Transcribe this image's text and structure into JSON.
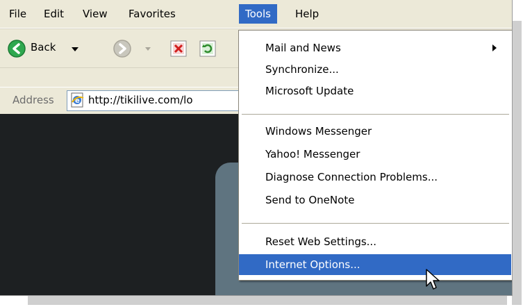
{
  "menubar": {
    "items": [
      {
        "label": "File"
      },
      {
        "label": "Edit"
      },
      {
        "label": "View"
      },
      {
        "label": "Favorites"
      },
      {
        "label": "Tools"
      },
      {
        "label": "Help"
      }
    ]
  },
  "toolbar": {
    "back_label": "Back"
  },
  "addressbar": {
    "label": "Address",
    "url": "http://tikilive.com/lo"
  },
  "tools_menu": {
    "items": [
      {
        "label": "Mail and News",
        "has_submenu": true
      },
      {
        "label": "Synchronize..."
      },
      {
        "label": "Microsoft Update"
      },
      {
        "label": "Windows Messenger"
      },
      {
        "label": "Yahoo! Messenger"
      },
      {
        "label": "Diagnose Connection Problems..."
      },
      {
        "label": "Send to OneNote"
      },
      {
        "label": "Reset Web Settings..."
      },
      {
        "label": "Internet Options...",
        "highlighted": true
      }
    ]
  },
  "colors": {
    "menu_highlight": "#316ac5",
    "chrome": "#ece9d8",
    "content_bg": "#1d2022"
  },
  "icons": [
    "back-arrow-icon",
    "dropdown-arrow-icon",
    "forward-arrow-icon",
    "stop-icon",
    "refresh-icon",
    "ie-page-icon",
    "submenu-arrow-icon",
    "mouse-cursor-icon"
  ]
}
